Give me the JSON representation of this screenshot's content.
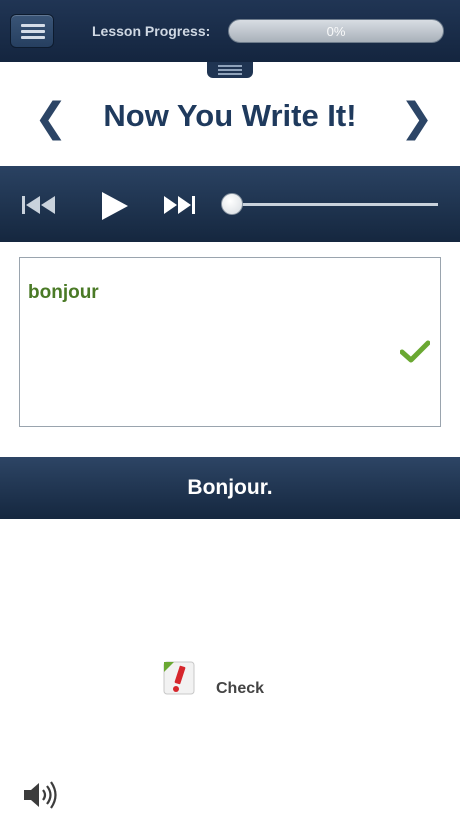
{
  "header": {
    "progress_label": "Lesson Progress:",
    "progress_value": 0,
    "progress_text": "0%"
  },
  "title_row": {
    "prev_symbol": "❮",
    "title": "Now You Write It!",
    "next_symbol": "❯"
  },
  "player": {
    "controls": [
      "skip-back-icon",
      "play-icon",
      "skip-forward-icon"
    ],
    "position": 0
  },
  "answer": {
    "value": "bonjour",
    "status_icon": "checkmark-icon",
    "correct_color": "#6aa832"
  },
  "translation": {
    "text": "Bonjour."
  },
  "check_action": {
    "label": "Check",
    "icon": "pencil-check-icon"
  },
  "audio": {
    "icon": "speaker-icon"
  },
  "colors": {
    "navy": "#1f3a5d",
    "bar_dark": "#15273f",
    "green_text": "#4a7a26"
  }
}
